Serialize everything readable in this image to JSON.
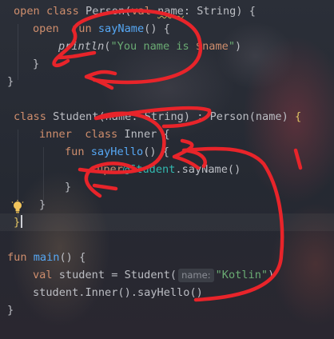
{
  "code": {
    "line1": {
      "kw1": "open",
      "kw2": "class",
      "cls": "Person",
      "kw3": "val",
      "param": "name",
      "type": "String",
      "open": "{"
    },
    "line2": {
      "kw1": "open",
      "kw2": "fun",
      "fn": "sayName",
      "open": "{"
    },
    "line3": {
      "fn": "println",
      "str1": "\"You name is ",
      "tmpl": "$name",
      "str2": "\""
    },
    "line4": {
      "close": "}"
    },
    "line5": {
      "close": "}"
    },
    "line7": {
      "kw1": "class",
      "cls": "Student",
      "param": "name",
      "type": "String",
      "parent": "Person",
      "arg": "name",
      "open": "{"
    },
    "line8": {
      "kw1": "inner",
      "kw2": "class",
      "cls": "Inner",
      "open": "{"
    },
    "line9": {
      "kw1": "fun",
      "fn": "sayHello",
      "open": "{"
    },
    "line10": {
      "kw1": "super",
      "label": "@Student",
      "fn": "sayName"
    },
    "line11": {
      "close": "}"
    },
    "line12": {
      "close": "}"
    },
    "line13": {
      "close": "}"
    },
    "line15": {
      "kw1": "fun",
      "fn": "main",
      "open": "{"
    },
    "line16": {
      "kw1": "val",
      "var": "student",
      "cls": "Student",
      "hint": "name:",
      "str": "\"Kotlin\""
    },
    "line17": {
      "var": "student",
      "cls": "Inner",
      "fn": "sayHello"
    },
    "line18": {
      "close": "}"
    }
  },
  "icons": {
    "bulb": "lightbulb-icon"
  },
  "colors": {
    "keyword": "#cf8e6d",
    "string": "#6aab73",
    "function": "#56a8f5",
    "label": "#32b8af",
    "annotation": "#e8242a"
  }
}
